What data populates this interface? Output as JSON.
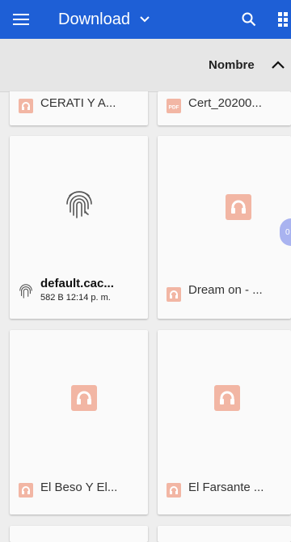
{
  "appbar": {
    "title": "Download",
    "menu_icon": "hamburger-menu-icon",
    "dropdown_icon": "chevron-down-icon",
    "search_icon": "search-icon",
    "view_icon": "grid-view-icon",
    "color": "#1e5fd6"
  },
  "sortbar": {
    "label": "Nombre",
    "direction_icon": "chevron-up-icon"
  },
  "files": [
    {
      "name": "CERATI Y A...",
      "type": "audio",
      "meta": ""
    },
    {
      "name": "Cert_20200...",
      "type": "pdf",
      "meta": ""
    },
    {
      "name": "default.cac...",
      "type": "fingerprint",
      "meta": "582 B 12:14 p. m."
    },
    {
      "name": "Dream on - ...",
      "type": "audio",
      "meta": ""
    },
    {
      "name": "El Beso Y El...",
      "type": "audio",
      "meta": ""
    },
    {
      "name": "El Farsante ...",
      "type": "audio",
      "meta": ""
    }
  ],
  "pdf_badge": "PDF",
  "fab_text": "0"
}
